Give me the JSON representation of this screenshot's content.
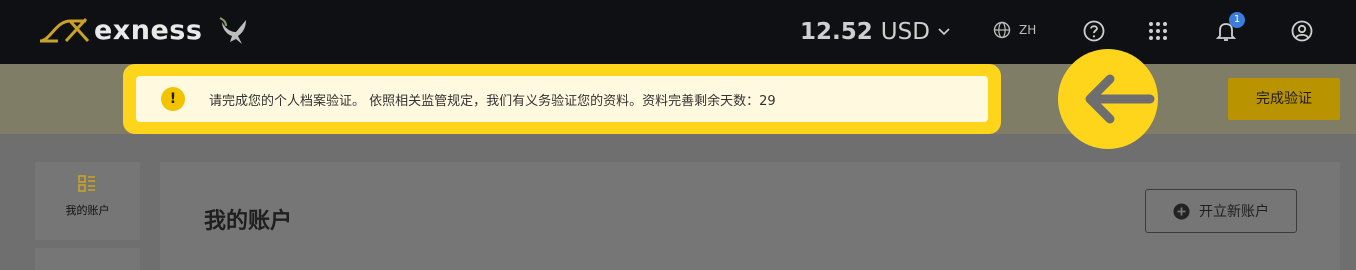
{
  "header": {
    "brand": "exness",
    "balance": {
      "amount": "12.52",
      "currency": "USD"
    },
    "language": "ZH",
    "notifications_count": "1",
    "icons": [
      "globe-icon",
      "help-icon",
      "apps-grid-icon",
      "bell-icon",
      "user-icon",
      "chevron-down-icon"
    ]
  },
  "banner": {
    "message": "请完成您的个人档案验证。 依照相关监管规定，我们有义务验证您的资料。资料完善剩余天数：29",
    "warning_symbol": "!",
    "action_label": "完成验证",
    "highlight_color": "#ffd51c"
  },
  "sidebar": {
    "items": [
      {
        "label": "我的账户",
        "icon": "accounts-icon"
      }
    ]
  },
  "main": {
    "title": "我的账户",
    "open_account_label": "开立新账户"
  }
}
